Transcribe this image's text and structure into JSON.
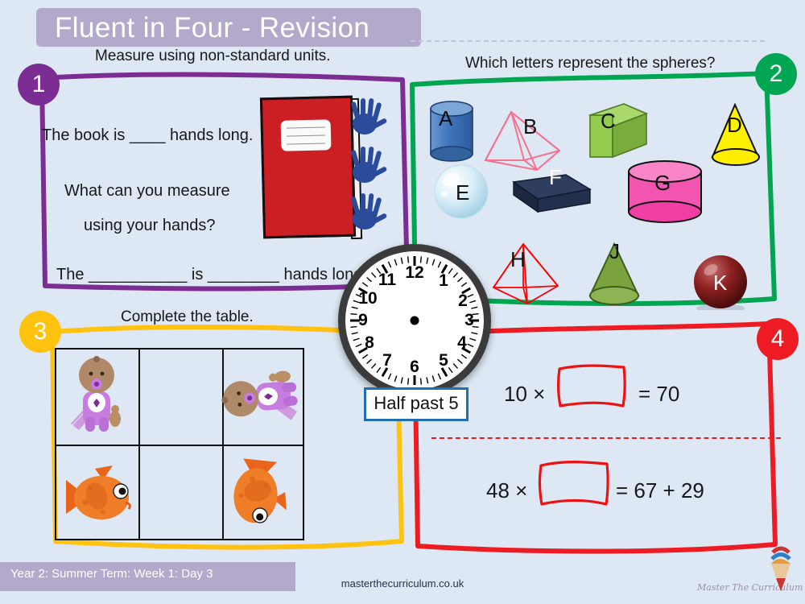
{
  "header": {
    "title": "Fluent in Four - Revision"
  },
  "panels": [
    {
      "number": "1",
      "accent": "#7b2d93",
      "prompt": "Measure using non-standard units.",
      "lines": [
        "The book is ____ hands long.",
        "What can you measure",
        "using your hands?",
        "The ___________ is ________ hands long."
      ],
      "illustration": "red-exercise-book-with-blue-handprints"
    },
    {
      "number": "2",
      "accent": "#00a551",
      "prompt": "Which letters represent the spheres?",
      "shapes": [
        {
          "letter": "A",
          "shape": "cylinder",
          "color": "#4a7fc1",
          "label_color": "#111111"
        },
        {
          "letter": "B",
          "shape": "pyramid-wireframe",
          "color": "#f2738d",
          "label_color": "#111111"
        },
        {
          "letter": "C",
          "shape": "cube",
          "color": "#8ec63f",
          "label_color": "#111111"
        },
        {
          "letter": "D",
          "shape": "cone",
          "color": "#fff200",
          "label_color": "#111111"
        },
        {
          "letter": "E",
          "shape": "sphere-bubble",
          "color": "#cfe8f2",
          "label_color": "#111111"
        },
        {
          "letter": "F",
          "shape": "cuboid",
          "color": "#23304d",
          "label_color": "#ffffff"
        },
        {
          "letter": "G",
          "shape": "cylinder",
          "color": "#f254b0",
          "label_color": "#111111"
        },
        {
          "letter": "H",
          "shape": "pyramid-wireframe",
          "color": "#ff0000",
          "label_color": "#111111"
        },
        {
          "letter": "J",
          "shape": "cone",
          "color": "#7aa33f",
          "label_color": "#111111"
        },
        {
          "letter": "K",
          "shape": "sphere",
          "color": "#7d1c1c",
          "label_color": "#ffffff"
        }
      ]
    },
    {
      "number": "3",
      "accent": "#ffc20e",
      "prompt": "Complete the table.",
      "table": {
        "rows": [
          [
            "baby-upright",
            "",
            "baby-rotated"
          ],
          [
            "fish-upright",
            "",
            "fish-rotated"
          ]
        ]
      }
    },
    {
      "number": "4",
      "accent": "#ed1c24",
      "equations": [
        {
          "left": "10 ×",
          "box": "",
          "right": "= 70"
        },
        {
          "left": "48 ×",
          "box": "",
          "right": "= 67 + 29"
        }
      ]
    }
  ],
  "clock": {
    "numbers": [
      "12",
      "1",
      "2",
      "3",
      "4",
      "5",
      "6",
      "7",
      "8",
      "9",
      "10",
      "11"
    ],
    "time_label": "Half past 5"
  },
  "footer": {
    "term": "Year 2: Summer Term: Week  1: Day 3",
    "url": "masterthecurriculum.co.uk",
    "brand": "Master The Curriculum"
  }
}
